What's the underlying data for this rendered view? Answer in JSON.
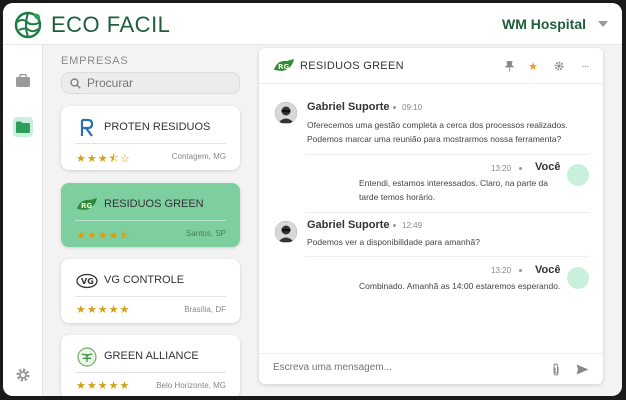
{
  "app": {
    "brand": "ECO FACIL",
    "hospital": "WM Hospital"
  },
  "rail": {
    "icons": [
      "briefcase-icon",
      "folder-icon",
      "gear-icon"
    ]
  },
  "companies": {
    "title": "EMPRESAS",
    "search_placeholder": "Procurar",
    "items": [
      {
        "name": "PROTEN RESIDUOS",
        "rating": 3.5,
        "stars": "★★★⯪☆",
        "location": "Contagem, MG"
      },
      {
        "name": "RESIDUOS GREEN",
        "rating": 3.5,
        "stars": "★★★★⯪",
        "location": "Santos, SP"
      },
      {
        "name": "VG CONTROLE",
        "rating": 5,
        "stars": "★★★★★",
        "location": "Brasília, DF"
      },
      {
        "name": "GREEN ALLIANCE",
        "rating": 5,
        "stars": "★★★★★",
        "location": "Belo Horizonte, MG"
      }
    ]
  },
  "chat": {
    "title": "RESIDUOS GREEN",
    "messages": [
      {
        "sender": "Gabriel Suporte",
        "time": "09:10",
        "line1": "Oferecemos uma gestão completa a cerca dos processos realizados.",
        "line2": "Podemos marcar uma reunião para mostrarmos nossa ferramenta?"
      },
      {
        "sender": "Você",
        "time": "13:20",
        "line1": "Entendi, estamos interessados. Claro, na parte da",
        "line2": "tarde temos horário."
      },
      {
        "sender": "Gabriel Suporte",
        "time": "12:49",
        "line1": "Podemos ver a disponibilidade para amanhã?",
        "line2": ""
      },
      {
        "sender": "Você",
        "time": "13:20",
        "line1": "Combinado. Amanhã as 14:00 estaremos esperando.",
        "line2": ""
      }
    ],
    "composer_placeholder": "Escreva uma mensagem..."
  },
  "colors": {
    "brand": "#1f5e3a",
    "active_card": "#7dcfa0",
    "star": "#d4a017",
    "self_avatar": "#c9f0dc"
  }
}
